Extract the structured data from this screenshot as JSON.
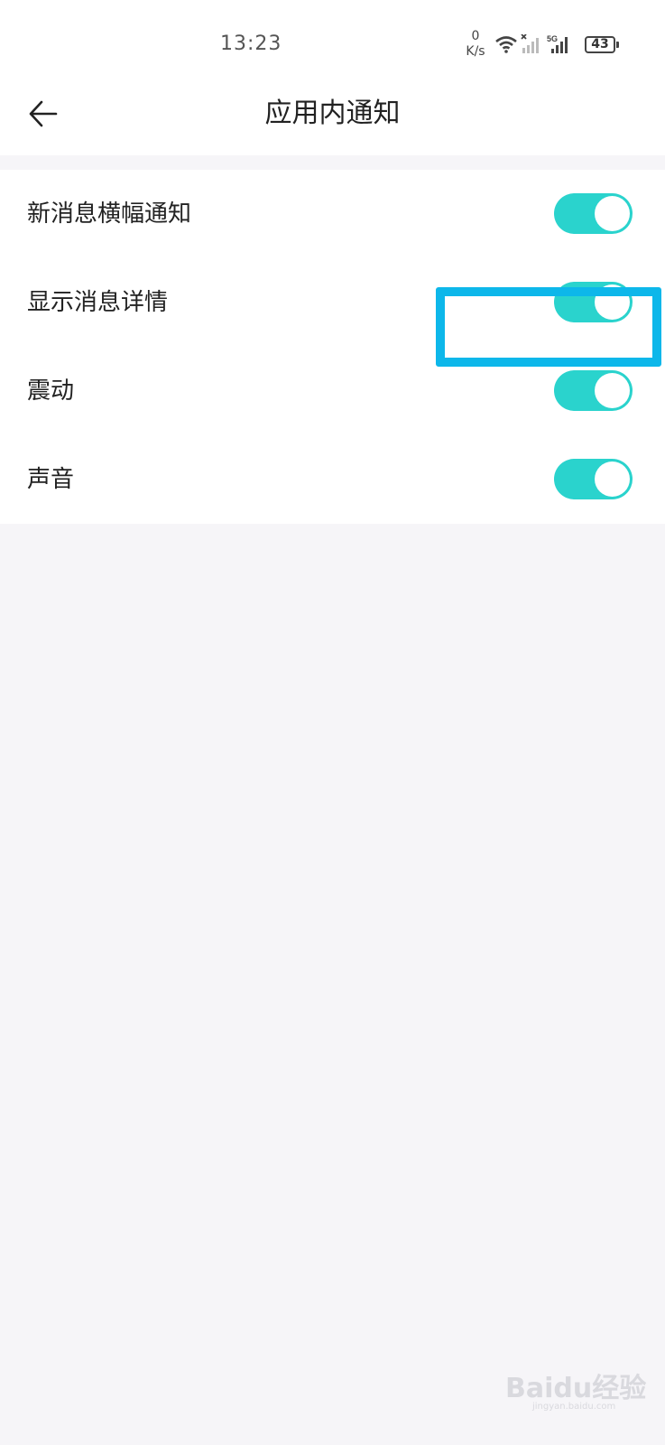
{
  "status_bar": {
    "time": "13:23",
    "net_speed_value": "0",
    "net_speed_unit": "K/s",
    "battery_level": "43",
    "network_type": "5G",
    "icons": [
      "wifi-icon",
      "signal-icon",
      "signal-5g-icon",
      "battery-icon"
    ]
  },
  "header": {
    "title": "应用内通知",
    "back_icon": "arrow-left-icon"
  },
  "settings": [
    {
      "label": "新消息横幅通知",
      "enabled": true
    },
    {
      "label": "显示消息详情",
      "enabled": true
    },
    {
      "label": "震动",
      "enabled": true
    },
    {
      "label": "声音",
      "enabled": true
    }
  ],
  "colors": {
    "toggle_on": "#2ad3cd",
    "highlight": "#0db7ea",
    "background": "#f6f5f8"
  },
  "watermark": {
    "logo_text": "Baidu经验",
    "url_text": "jingyan.baidu.com"
  }
}
